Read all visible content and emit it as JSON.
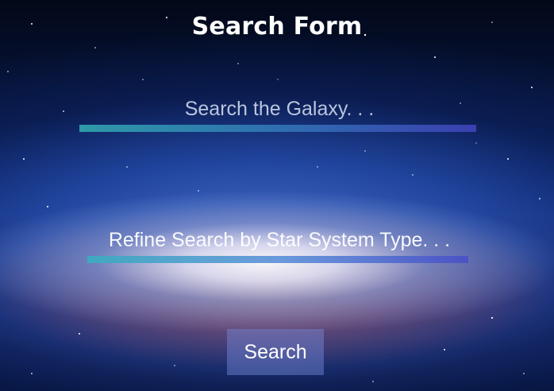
{
  "header": {
    "title": "Search Form"
  },
  "form": {
    "galaxy_search": {
      "placeholder": "Search the Galaxy. . .",
      "value": ""
    },
    "refine_search": {
      "placeholder": "Refine Search by Star System Type. . .",
      "value": ""
    },
    "submit_label": "Search"
  },
  "colors": {
    "underline_start": "#2e9aa8",
    "underline_end": "#3a3fb0",
    "button_bg": "rgba(120,140,220,0.45)",
    "text": "#ffffff"
  }
}
